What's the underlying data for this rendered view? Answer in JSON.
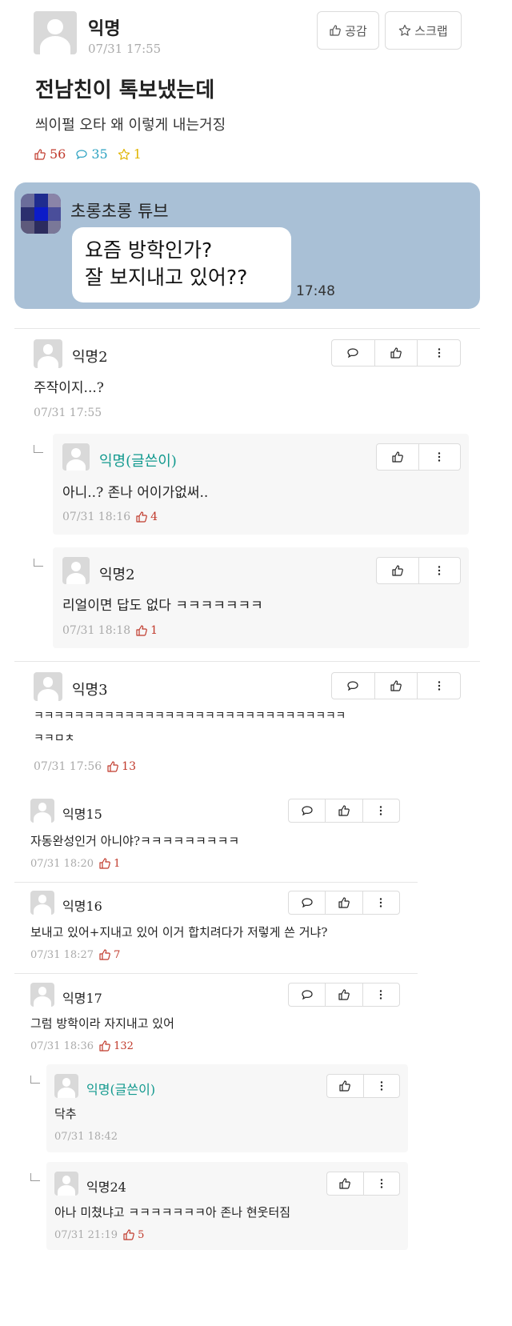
{
  "post": {
    "author": "익명",
    "time": "07/31 17:55",
    "title": "전남친이 톡보냈는데",
    "body": "씌이펄 오타 왜 이렇게 내는거징",
    "likes": "56",
    "comments": "35",
    "scraps": "1",
    "btn_like": "공감",
    "btn_scrap": "스크랩"
  },
  "chat": {
    "sender": "초롱초롱 튜브",
    "line1": "요즘 방학인가?",
    "line2": "잘 보지내고 있어??",
    "time": "17:48"
  },
  "comments": [
    {
      "author": "익명2",
      "text": "주작이지...?",
      "time": "07/31 17:55",
      "likes": ""
    },
    {
      "author": "익명(글쓴이)",
      "text": "아니..? 존나 어이가없써..",
      "time": "07/31 18:16",
      "likes": "4"
    },
    {
      "author": "익명2",
      "text": "리얼이면 답도 없다 ㅋㅋㅋㅋㅋㅋㅋ",
      "time": "07/31 18:18",
      "likes": "1"
    },
    {
      "author": "익명3",
      "text": "ㅋㅋㅋㅋㅋㅋㅋㅋㅋㅋㅋㅋㅋㅋㅋㅋㅋㅋㅋㅋㅋㅋㅋㅋㅋㅋㅋㅋㅋㅋㅋ",
      "text2": "ㅋㅋㅁㅊ",
      "time": "07/31 17:56",
      "likes": "13"
    },
    {
      "author": "익명15",
      "text": "자동완성인거 아니야?ㅋㅋㅋㅋㅋㅋㅋㅋㅋ",
      "time": "07/31 18:20",
      "likes": "1"
    },
    {
      "author": "익명16",
      "text": "보내고 있어+지내고 있어 이거 합치려다가 저렇게 쓴 거냐?",
      "time": "07/31 18:27",
      "likes": "7"
    },
    {
      "author": "익명17",
      "text": "그럼 방학이라 자지내고 있어",
      "time": "07/31 18:36",
      "likes": "132"
    },
    {
      "author": "익명(글쓴이)",
      "text": "닥추",
      "time": "07/31 18:42",
      "likes": ""
    },
    {
      "author": "익명24",
      "text": "아나 미쳤냐고 ㅋㅋㅋㅋㅋㅋㅋ아 존나 현웃터짐",
      "time": "07/31 21:19",
      "likes": "5"
    }
  ]
}
